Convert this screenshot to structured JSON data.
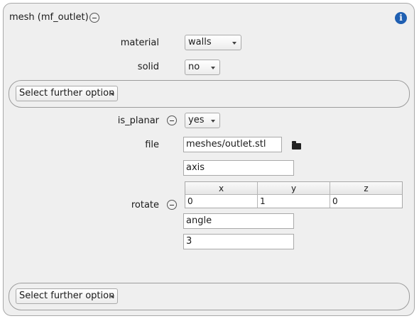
{
  "panel": {
    "title": "mesh (mf_outlet)"
  },
  "icons": {
    "info": "i",
    "info_color": "#1f5fb2"
  },
  "material": {
    "label": "material",
    "value": "walls"
  },
  "solid": {
    "label": "solid",
    "value": "no"
  },
  "further_option_top": {
    "label": "Select further option"
  },
  "is_planar": {
    "label": "is_planar",
    "value": "yes"
  },
  "file": {
    "label": "file",
    "value": "meshes/outlet.stl"
  },
  "rotate": {
    "label": "rotate",
    "axis_label": "axis",
    "columns": [
      "x",
      "y",
      "z"
    ],
    "values": [
      "0",
      "1",
      "0"
    ],
    "angle_label": "angle",
    "angle_value": "3"
  },
  "further_option_bottom": {
    "label": "Select further option"
  }
}
